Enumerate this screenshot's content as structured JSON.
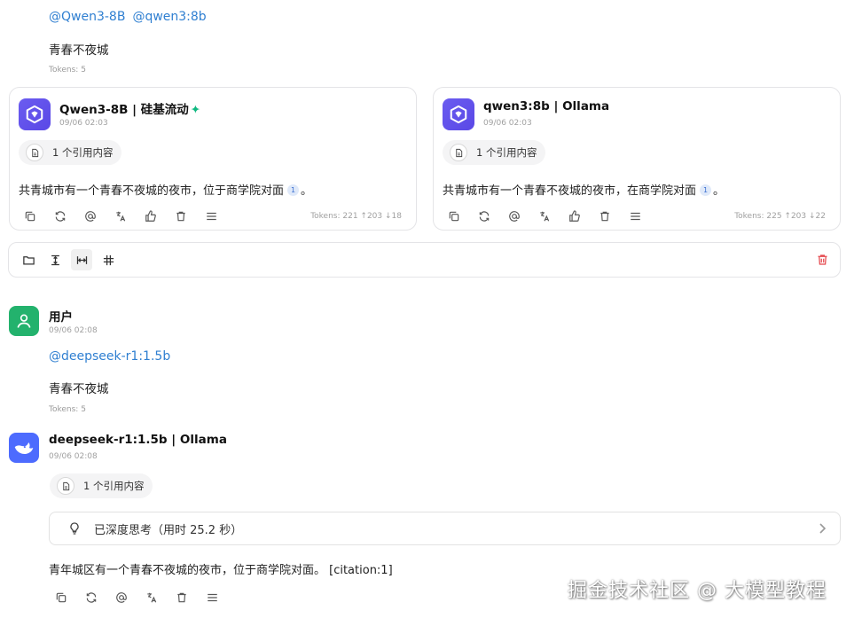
{
  "top_user_message": {
    "mentions": [
      "@Qwen3-8B",
      "@qwen3:8b"
    ],
    "text": "青春不夜城",
    "tokens": "Tokens: 5"
  },
  "replies": [
    {
      "model": "Qwen3-8B | 硅基流动",
      "sparkle": "✦",
      "time": "09/06 02:03",
      "citation_label": "1 个引用内容",
      "answer_before": "共青城市有一个青春不夜城的夜市，位于商学院对面",
      "citation_num": "1",
      "answer_after": "。",
      "tokens": "Tokens: 221 ↑203 ↓18"
    },
    {
      "model": "qwen3:8b | Ollama",
      "time": "09/06 02:03",
      "citation_label": "1 个引用内容",
      "answer_before": "共青城市有一个青春不夜城的夜市，在商学院对面",
      "citation_num": "1",
      "answer_after": "。",
      "tokens": "Tokens: 225 ↑203 ↓22"
    }
  ],
  "user_message": {
    "name": "用户",
    "time": "09/06 02:08",
    "mention": "@deepseek-r1:1.5b",
    "text": "青春不夜城",
    "tokens": "Tokens: 5"
  },
  "deepseek_reply": {
    "model": "deepseek-r1:1.5b | Ollama",
    "time": "09/06 02:08",
    "citation_label": "1 个引用内容",
    "thinking_label": "已深度思考（用时 25.2 秒）",
    "answer": "青年城区有一个青春不夜城的夜市，位于商学院对面。 [citation:1]"
  },
  "watermark": "掘金技术社区 @ 大模型教程",
  "colors": {
    "accent_link": "#2f7fd1",
    "qwen_brand": "#5a48e6",
    "deepseek_brand": "#4d6bfe",
    "user_avatar": "#23b26d",
    "delete_red": "#e5484d",
    "sparkle_green": "#10b981"
  },
  "icons": {
    "message_actions": [
      "copy-icon",
      "regenerate-icon",
      "mention-icon",
      "translate-icon",
      "thumbs-up-icon",
      "delete-icon",
      "menu-icon"
    ],
    "layout_toolbar": [
      "folder-icon",
      "text-height-icon",
      "column-width-icon",
      "grid-icon",
      "trash-icon"
    ]
  }
}
